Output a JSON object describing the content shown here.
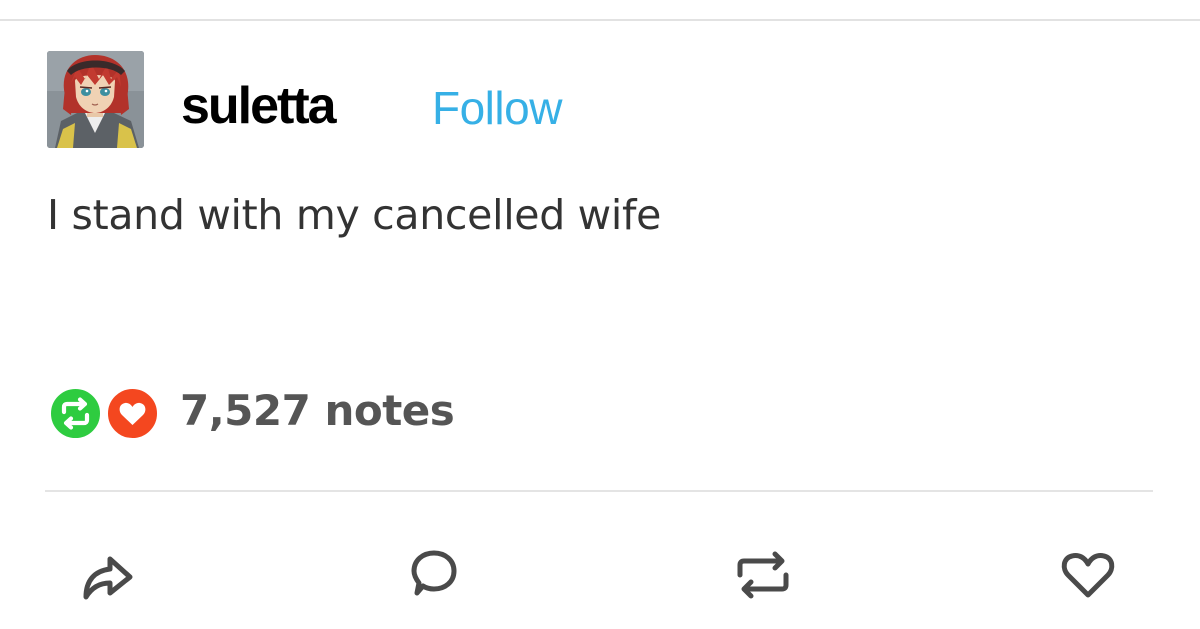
{
  "post": {
    "username": "suletta",
    "follow_label": "Follow",
    "body_text": "I stand with my cancelled wife",
    "notes_label": "7,527 notes"
  },
  "avatar": {
    "icon": "anime-character-avatar"
  },
  "note_badges": [
    {
      "icon": "reblog-icon",
      "color": "#2ecc40"
    },
    {
      "icon": "heart-icon",
      "color": "#f4471f"
    }
  ],
  "actions": [
    {
      "icon": "share-icon"
    },
    {
      "icon": "reply-icon"
    },
    {
      "icon": "reblog-icon"
    },
    {
      "icon": "heart-icon"
    }
  ],
  "colors": {
    "follow_link": "#36b0e6",
    "username": "#000000",
    "body_text": "#333333",
    "notes_text": "#555555",
    "action_icons": "#4a4a4a",
    "divider": "#e2e2e2"
  }
}
